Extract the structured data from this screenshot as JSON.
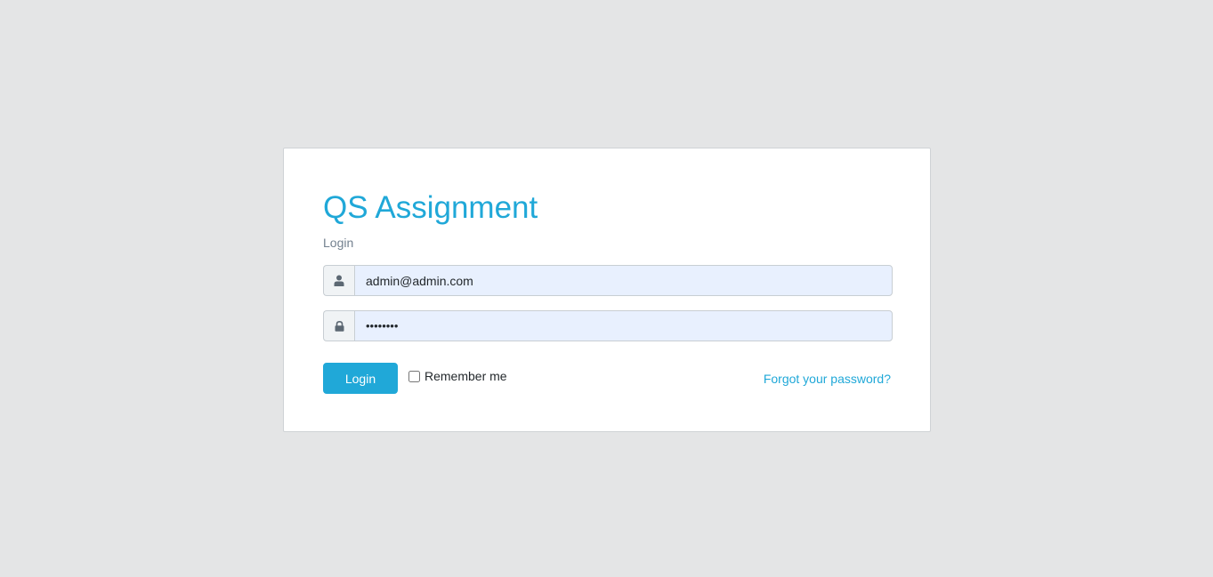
{
  "login": {
    "title": "QS Assignment",
    "subtitle": "Login",
    "email_value": "admin@admin.com",
    "password_value": "••••••••",
    "login_button_label": "Login",
    "remember_label": "Remember me",
    "remember_checked": false,
    "forgot_link_label": "Forgot your password?"
  },
  "icons": {
    "email": "user-icon",
    "password": "lock-icon"
  },
  "colors": {
    "accent": "#20a8d8",
    "page_background": "#e4e5e6",
    "field_background": "#e8f0fe",
    "muted_text": "#73818f"
  }
}
